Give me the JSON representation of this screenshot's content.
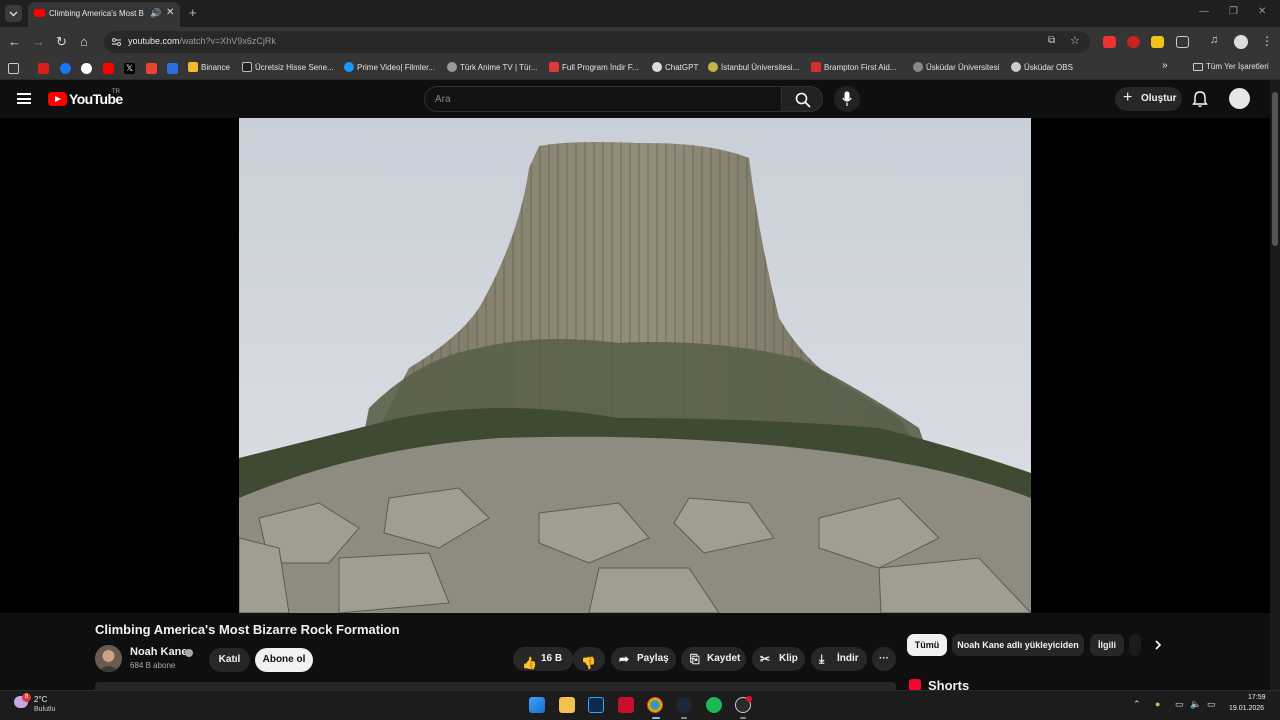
{
  "browser": {
    "tab": {
      "title": "Climbing America's Most B",
      "audio_icon": "speaker-icon",
      "close": "✕"
    },
    "new_tab": "+",
    "url_host": "youtube.com",
    "url_path": "/watch?v=XhV9x6zCjRk",
    "bookmarks": [
      "Binance",
      "Ücretsiz Hisse Sene...",
      "Prime Video| Filmler...",
      "Türk Anime TV | Tür...",
      "Full Program İndir F...",
      "ChatGPT",
      "İstanbul Üniversitesi...",
      "Brampton First Aid...",
      "Üsküdar Üniversitesi",
      "Üsküdar OBS"
    ],
    "bookmarks_more": "»",
    "all_bookmarks": "Tüm Yer İşaretleri"
  },
  "header": {
    "logo_text": "YouTube",
    "country": "TR",
    "search_placeholder": "Ara",
    "create_label": "Oluştur"
  },
  "video": {
    "title": "Climbing America's Most Bizarre Rock Formation",
    "channel": "Noah Kane",
    "subscribers": "684 B abone",
    "join_label": "Katıl",
    "subscribe_label": "Abone ol",
    "likes": "16 B",
    "share_label": "Paylaş",
    "save_label": "Kaydet",
    "clip_label": "Klip",
    "download_label": "İndir",
    "more_label": "···"
  },
  "chips": [
    "Tümü",
    "Noah Kane adlı yükleyiciden",
    "İlgili"
  ],
  "shorts_title": "Shorts",
  "taskbar": {
    "temperature": "2°C",
    "condition": "Bulutlu",
    "weather_badge": "8",
    "time": "17:59",
    "date": "19.01.2026"
  },
  "colors": {
    "brand_red": "#ff0000",
    "background": "#0f0f0f",
    "pill": "#272727"
  }
}
